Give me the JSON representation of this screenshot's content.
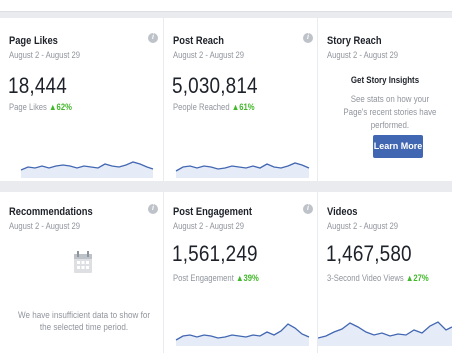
{
  "cards": {
    "page_likes": {
      "title": "Page Likes",
      "date_range": "August 2 - August 29",
      "value": "18,444",
      "metric_label": "Page Likes",
      "change": "▲62%"
    },
    "post_reach": {
      "title": "Post Reach",
      "date_range": "August 2 - August 29",
      "value": "5,030,814",
      "metric_label": "People Reached",
      "change": "▲61%"
    },
    "story_reach": {
      "title": "Story Reach",
      "date_range": "August 2 - August 29",
      "insights_title": "Get Story Insights",
      "insights_desc": "See stats on how your Page's recent stories have performed.",
      "button_label": "Learn More"
    },
    "recommendations": {
      "title": "Recommendations",
      "date_range": "August 2 - August 29",
      "empty_message": "We have insufficient data to show for the selected time period."
    },
    "post_engagement": {
      "title": "Post Engagement",
      "date_range": "August 2 - August 29",
      "value": "1,561,249",
      "metric_label": "Post Engagement",
      "change": "▲39%"
    },
    "videos": {
      "title": "Videos",
      "date_range": "August 2 - August 29",
      "value": "1,467,580",
      "metric_label": "3-Second Video Views",
      "change": "▲27%"
    }
  },
  "info_glyph": "i",
  "colors": {
    "background": "#e9ebee",
    "card": "#ffffff",
    "line": "#4267b2",
    "area": "#e6ecf7",
    "positive": "#42b72a",
    "button": "#4267b2",
    "muted": "#90949c"
  },
  "icons": {
    "info": "info-icon",
    "calendar": "calendar-icon"
  }
}
